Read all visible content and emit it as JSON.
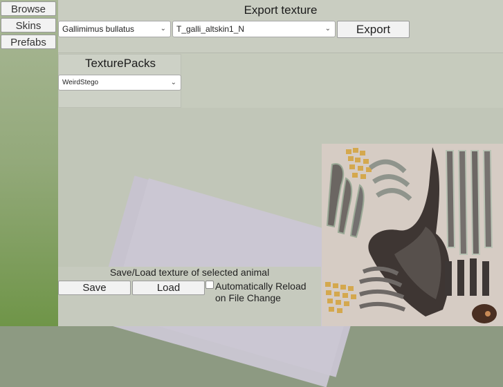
{
  "sidebar": {
    "items": [
      {
        "label": "Browse"
      },
      {
        "label": "Skins"
      },
      {
        "label": "Prefabs"
      }
    ]
  },
  "export": {
    "title": "Export texture",
    "species_select": {
      "value": "Gallimimus bullatus"
    },
    "texture_select": {
      "value": "T_galli_altskin1_N"
    },
    "export_button": "Export"
  },
  "texture_packs": {
    "title": "TexturePacks",
    "select": {
      "value": "WeirdStego"
    }
  },
  "save_load": {
    "title": "Save/Load texture of selected animal",
    "save_button": "Save",
    "load_button": "Load",
    "auto_reload": {
      "label": "Automatically Reload on File Change",
      "checked": false
    }
  },
  "icons": {
    "dropdown": "chevron-down-icon"
  },
  "colors": {
    "panel": "#c9cdc1",
    "button": "#f2f2f2",
    "preview_bg": "#cfc8c2"
  }
}
